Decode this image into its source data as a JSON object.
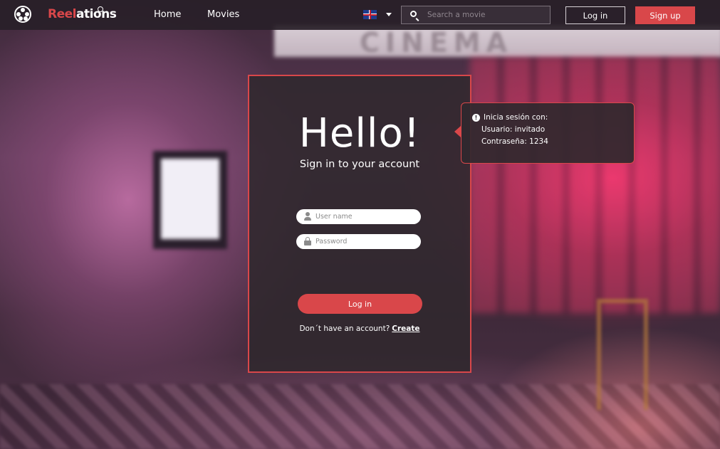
{
  "header": {
    "brand_part1": "Reel",
    "brand_part2": "ations",
    "nav": [
      "Home",
      "Movies"
    ],
    "language_icon": "uk-flag-icon",
    "search_placeholder": "Search a movie",
    "login_label": "Log in",
    "signup_label": "Sign up"
  },
  "login_card": {
    "title": "Hello!",
    "subtitle": "Sign in to your account",
    "username_placeholder": "User name",
    "password_placeholder": "Password",
    "submit_label": "Log in",
    "no_account_text": "Don´t have an account?",
    "create_link": "Create"
  },
  "tooltip": {
    "line1": "Inicia sesión con:",
    "line2": "Usuario: invitado",
    "line3": "Contraseña: 1234"
  },
  "colors": {
    "accent": "#d9474a",
    "header_bg": "#28202a",
    "card_bg": "#30282e"
  }
}
